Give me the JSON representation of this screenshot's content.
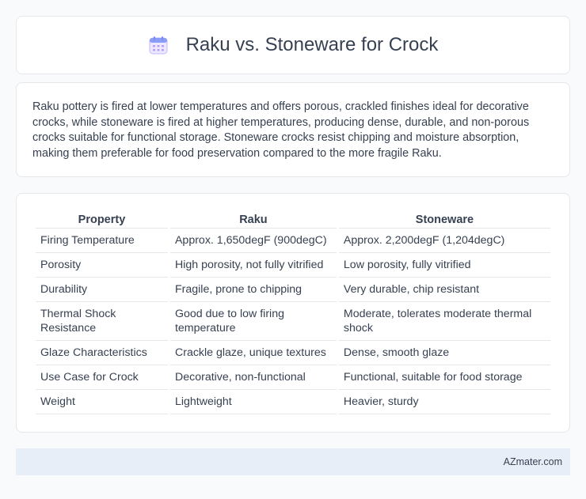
{
  "header": {
    "title": "Raku vs. Stoneware for Crock",
    "icon": "calendar-icon",
    "icon_color": "#8b7cf6"
  },
  "summary": {
    "text": "Raku pottery is fired at lower temperatures and offers porous, crackled finishes ideal for decorative crocks, while stoneware is fired at higher temperatures, producing dense, durable, and non-porous crocks suitable for functional storage. Stoneware crocks resist chipping and moisture absorption, making them preferable for food preservation compared to the more fragile Raku."
  },
  "table": {
    "headers": [
      "Property",
      "Raku",
      "Stoneware"
    ],
    "rows": [
      [
        "Firing Temperature",
        "Approx. 1,650degF (900degC)",
        "Approx. 2,200degF (1,204degC)"
      ],
      [
        "Porosity",
        "High porosity, not fully vitrified",
        "Low porosity, fully vitrified"
      ],
      [
        "Durability",
        "Fragile, prone to chipping",
        "Very durable, chip resistant"
      ],
      [
        "Thermal Shock Resistance",
        "Good due to low firing temperature",
        "Moderate, tolerates moderate thermal shock"
      ],
      [
        "Glaze Characteristics",
        "Crackle glaze, unique textures",
        "Dense, smooth glaze"
      ],
      [
        "Use Case for Crock",
        "Decorative, non-functional",
        "Functional, suitable for food storage"
      ],
      [
        "Weight",
        "Lightweight",
        "Heavier, sturdy"
      ]
    ]
  },
  "footer": {
    "text": "AZmater.com"
  }
}
